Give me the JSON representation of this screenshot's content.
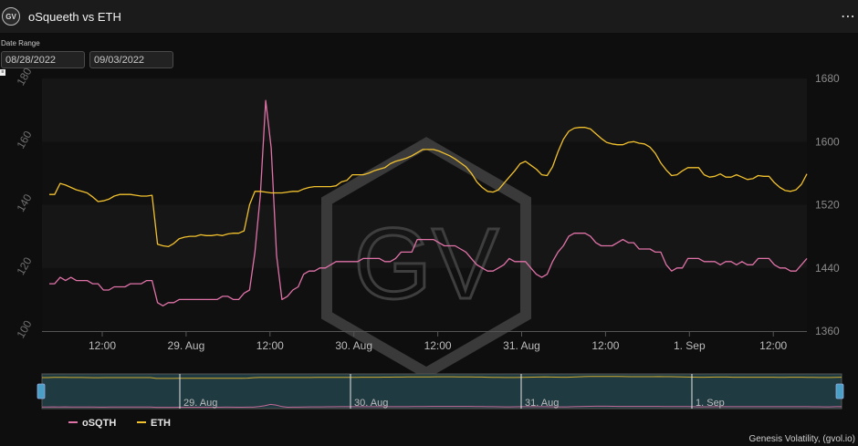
{
  "header": {
    "logo_text": "GV",
    "title": "oSqueeth vs ETH",
    "menu_label": "⋯"
  },
  "date_range": {
    "label": "Date Range",
    "start": "08/28/2022",
    "end": "09/03/2022"
  },
  "tiny_marker": "≡",
  "watermark": "GV",
  "credit": "Genesis Volatility, (gvol.io)",
  "colors": {
    "osqth": "#e072a8",
    "eth": "#f2c12e",
    "background": "#0e0e0e",
    "navigator_fill": "#1f3a40"
  },
  "chart_data": {
    "type": "line",
    "x_labels": [
      "12:00",
      "29. Aug",
      "12:00",
      "30. Aug",
      "12:00",
      "31. Aug",
      "12:00",
      "1. Sep",
      "12:00"
    ],
    "navigator_labels": [
      "29. Aug",
      "30. Aug",
      "31. Aug",
      "1. Sep"
    ],
    "y_left": {
      "ticks": [
        100,
        120,
        140,
        160,
        180
      ],
      "range": [
        100,
        180
      ]
    },
    "y_right": {
      "ticks": [
        1360,
        1440,
        1520,
        1600,
        1680
      ],
      "range": [
        1360,
        1680
      ]
    },
    "legend_position": "bottom-left",
    "series": [
      {
        "name": "oSQTH",
        "axis": "left",
        "color": "#e072a8",
        "values": [
          115,
          115,
          117,
          116,
          117,
          116,
          116,
          116,
          115,
          115,
          113,
          113,
          114,
          114,
          114,
          115,
          115,
          115,
          116,
          116,
          109,
          108,
          109,
          109,
          110,
          110,
          110,
          110,
          110,
          110,
          110,
          110,
          111,
          111,
          110,
          110,
          112,
          113,
          125,
          143,
          173,
          158,
          124,
          110,
          111,
          113,
          114,
          118,
          119,
          119,
          120,
          120,
          121,
          122,
          122,
          122,
          122,
          122,
          123,
          123,
          123,
          123,
          122,
          122,
          123,
          125,
          125,
          125,
          129,
          129,
          129,
          129,
          128,
          127,
          127,
          127,
          126,
          125,
          123,
          121,
          120,
          119,
          119,
          120,
          121,
          123,
          122,
          122,
          122,
          120,
          118,
          117,
          118,
          122,
          125,
          127,
          130,
          131,
          131,
          131,
          130,
          128,
          127,
          127,
          127,
          128,
          129,
          128,
          128,
          126,
          126,
          126,
          125,
          125,
          121,
          119,
          120,
          120,
          123,
          123,
          123,
          122,
          122,
          122,
          121,
          122,
          122,
          121,
          122,
          121,
          121,
          123,
          123,
          123,
          121,
          120,
          120,
          119,
          119,
          121,
          123
        ]
      },
      {
        "name": "ETH",
        "axis": "right",
        "color": "#f2c12e",
        "values": [
          1533,
          1533,
          1547,
          1545,
          1542,
          1539,
          1537,
          1535,
          1530,
          1524,
          1525,
          1527,
          1531,
          1533,
          1533,
          1533,
          1532,
          1531,
          1531,
          1532,
          1470,
          1468,
          1467,
          1471,
          1477,
          1479,
          1480,
          1480,
          1482,
          1481,
          1481,
          1482,
          1481,
          1483,
          1484,
          1484,
          1487,
          1520,
          1537,
          1537,
          1536,
          1535,
          1535,
          1535,
          1536,
          1537,
          1537,
          1540,
          1542,
          1543,
          1543,
          1543,
          1543,
          1544,
          1549,
          1551,
          1558,
          1558,
          1558,
          1560,
          1563,
          1565,
          1567,
          1572,
          1575,
          1577,
          1579,
          1582,
          1586,
          1590,
          1590,
          1590,
          1588,
          1585,
          1582,
          1578,
          1573,
          1568,
          1560,
          1549,
          1542,
          1537,
          1536,
          1539,
          1547,
          1555,
          1563,
          1572,
          1575,
          1570,
          1565,
          1558,
          1557,
          1568,
          1587,
          1603,
          1613,
          1617,
          1618,
          1618,
          1616,
          1610,
          1604,
          1599,
          1597,
          1596,
          1596,
          1599,
          1600,
          1598,
          1597,
          1593,
          1585,
          1573,
          1564,
          1557,
          1558,
          1563,
          1567,
          1567,
          1567,
          1558,
          1555,
          1556,
          1559,
          1555,
          1555,
          1558,
          1555,
          1552,
          1553,
          1557,
          1556,
          1556,
          1548,
          1542,
          1538,
          1537,
          1539,
          1546,
          1559
        ]
      }
    ]
  }
}
